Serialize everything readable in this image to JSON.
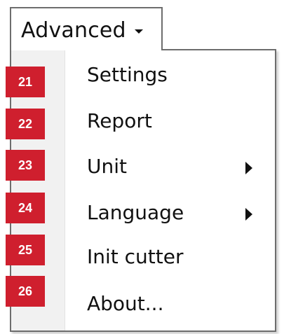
{
  "menu": {
    "title": "Advanced",
    "items": [
      {
        "label": "Settings",
        "badge": "21",
        "has_submenu": false
      },
      {
        "label": "Report",
        "badge": "22",
        "has_submenu": false
      },
      {
        "label": "Unit",
        "badge": "23",
        "has_submenu": true
      },
      {
        "label": "Language",
        "badge": "24",
        "has_submenu": true
      },
      {
        "label": "Init cutter",
        "badge": "25",
        "has_submenu": false
      },
      {
        "label": "About...",
        "badge": "26",
        "has_submenu": false
      }
    ]
  },
  "colors": {
    "badge": "#cf1f2e",
    "border": "#6d6d6d",
    "icon_column": "#f1f1f1"
  },
  "icons": {
    "dropdown": "chevron-down-icon",
    "submenu": "chevron-right-icon"
  }
}
